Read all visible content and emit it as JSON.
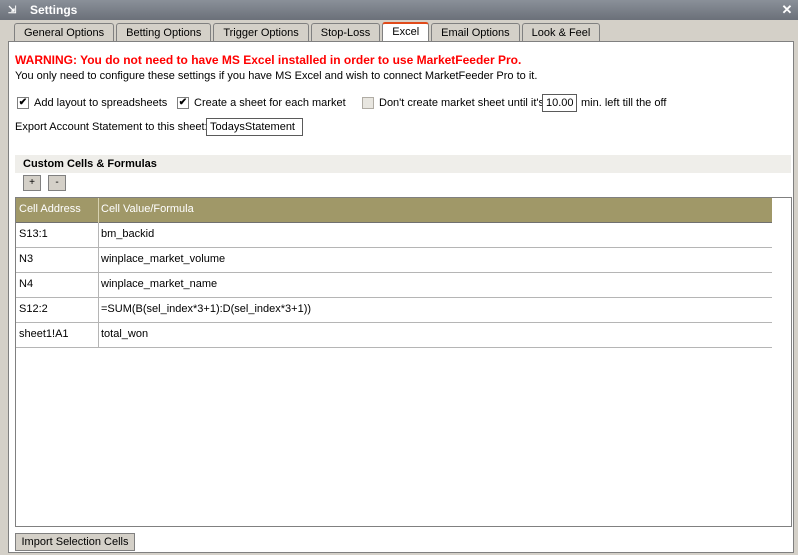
{
  "window": {
    "title": "Settings",
    "close_glyph": "✕"
  },
  "tabs": [
    {
      "label": "General Options"
    },
    {
      "label": "Betting Options"
    },
    {
      "label": "Trigger Options"
    },
    {
      "label": "Stop-Loss"
    },
    {
      "label": "Excel",
      "active": true
    },
    {
      "label": "Email Options"
    },
    {
      "label": "Look & Feel"
    }
  ],
  "warning": "WARNING: You do not need to have MS Excel installed in order to use MarketFeeder Pro.",
  "subtext": "You only need to configure these settings if you have MS Excel and wish to connect MarketFeeder Pro to it.",
  "options": {
    "add_layout": {
      "label": "Add layout to spreadsheets",
      "checked": true
    },
    "create_sheet": {
      "label": "Create a sheet for each market",
      "checked": true
    },
    "dont_create": {
      "label": "Don't create market sheet until it's",
      "checked": false
    },
    "minutes_value": "10.00",
    "minutes_label": "min. left till the off"
  },
  "export": {
    "label": "Export Account Statement to this sheet:",
    "value": "TodaysStatement"
  },
  "custom_cells": {
    "title": "Custom Cells & Formulas",
    "add_label": "+",
    "remove_label": "-",
    "columns": [
      "Cell Address",
      "Cell Value/Formula"
    ],
    "rows": [
      {
        "address": "S13:1",
        "value": "bm_backid"
      },
      {
        "address": "N3",
        "value": "winplace_market_volume"
      },
      {
        "address": "N4",
        "value": "winplace_market_name"
      },
      {
        "address": "S12:2",
        "value": "=SUM(B(sel_index*3+1):D(sel_index*3+1))"
      },
      {
        "address": "sheet1!A1",
        "value": "total_won"
      }
    ]
  },
  "import_button": "Import Selection Cells",
  "colors": {
    "header_bg": "#a09868",
    "active_tab_accent": "#e04a1a",
    "warning": "#ff0000",
    "titlebar": "#6b7079"
  }
}
